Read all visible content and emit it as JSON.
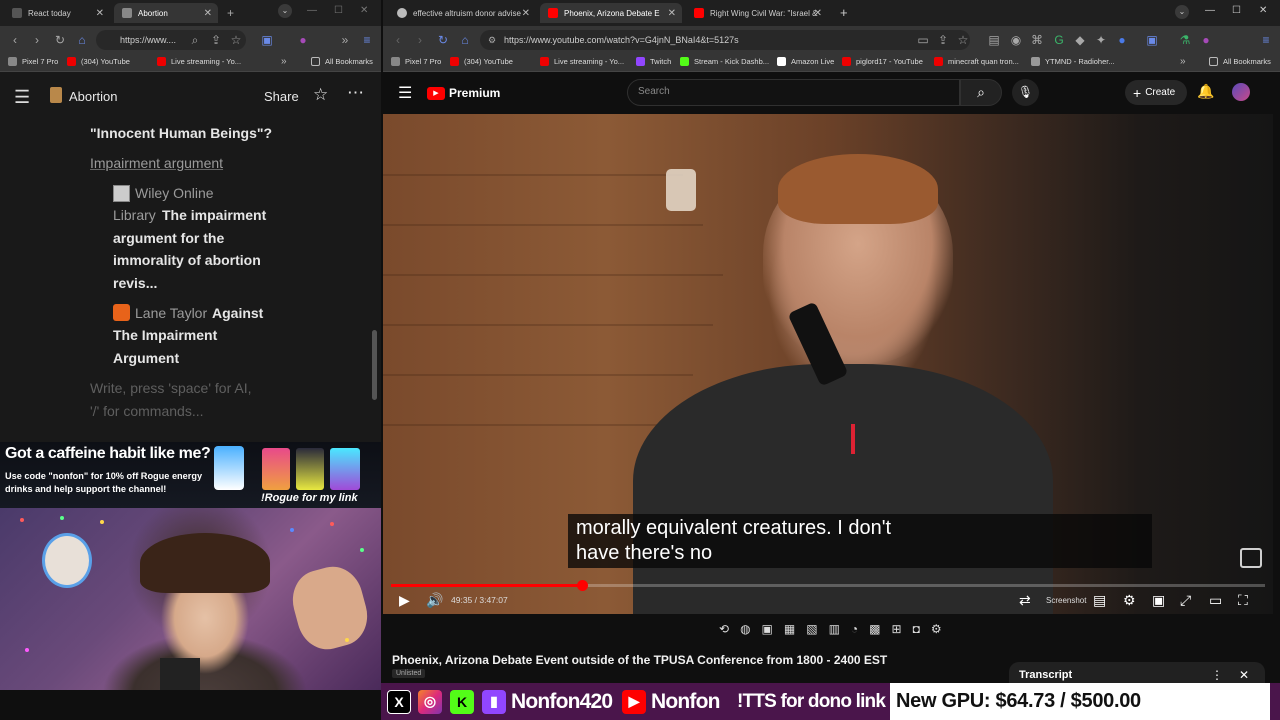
{
  "left_browser": {
    "tabs": [
      {
        "label": "React today",
        "active": false
      },
      {
        "label": "Abortion",
        "active": true
      }
    ],
    "url": "https://www....",
    "bookmarks": [
      "Pixel 7 Pro",
      "(304) YouTube",
      "Live streaming - Yo..."
    ],
    "all_bookmarks": "All Bookmarks",
    "notion": {
      "page_title": "Abortion",
      "share_label": "Share",
      "lines": {
        "innocent": "\"Innocent Human Beings\"?",
        "impairment_link": "Impairment argument",
        "wiley_source": "Wiley Online",
        "wiley_source2": "Library",
        "wiley_title1": "The impairment",
        "wiley_title2": "argument for the",
        "wiley_title3": "immorality of abortion",
        "wiley_title4": "revis...",
        "lane_source": "Lane Taylor",
        "lane_title1": "Against",
        "lane_title2": "The Impairment",
        "lane_title3": "Argument",
        "placeholder1": "Write, press 'space' for AI,",
        "placeholder2": "'/' for commands..."
      }
    }
  },
  "right_browser": {
    "tabs": [
      {
        "label": "effective altruism donor advise",
        "active": false
      },
      {
        "label": "Phoenix, Arizona Debate E",
        "active": true
      },
      {
        "label": "Right Wing Civil War: \"Israel &",
        "active": false
      }
    ],
    "url": "https://www.youtube.com/watch?v=G4jnN_BNaI4&t=5127s",
    "bookmarks": [
      "Pixel 7 Pro",
      "(304) YouTube",
      "Live streaming - Yo...",
      "Twitch",
      "Stream - Kick Dashb...",
      "Amazon Live",
      "piglord17 - YouTube",
      "minecraft quan tron...",
      "YTMND - Radioher..."
    ],
    "all_bookmarks": "All Bookmarks"
  },
  "youtube": {
    "logo_text": "Premium",
    "search_placeholder": "Search",
    "create_label": "Create",
    "caption_line1": "morally equivalent creatures. I don't",
    "caption_line2": "have there's no",
    "time_current": "49:35",
    "time_total": "3:47:07",
    "time_display": "49:35 / 3:47:07",
    "progress_fraction": 0.218,
    "screenshot_label": "Screenshot",
    "video_title": "Phoenix, Arizona Debate Event outside of the TPUSA Conference from 1800 - 2400 EST",
    "unlisted_label": "Unlisted",
    "transcript_label": "Transcript"
  },
  "stream_overlay": {
    "promo_headline": "Got a caffeine habit like me?",
    "promo_body1": "Use code \"nonfon\" for 10% off Rogue energy",
    "promo_body2": "drinks and help support the channel!",
    "promo_cta": "!Rogue for my link",
    "ticker": {
      "handle1": "Nonfon420",
      "handle2": "Nonfon",
      "tts": "!TTS for dono link",
      "goal": "New GPU: $64.73 / $500.00"
    }
  },
  "colors": {
    "youtube_red": "#ff0000",
    "ticker_bg": "#4a154b",
    "notion_bg": "#191919"
  }
}
